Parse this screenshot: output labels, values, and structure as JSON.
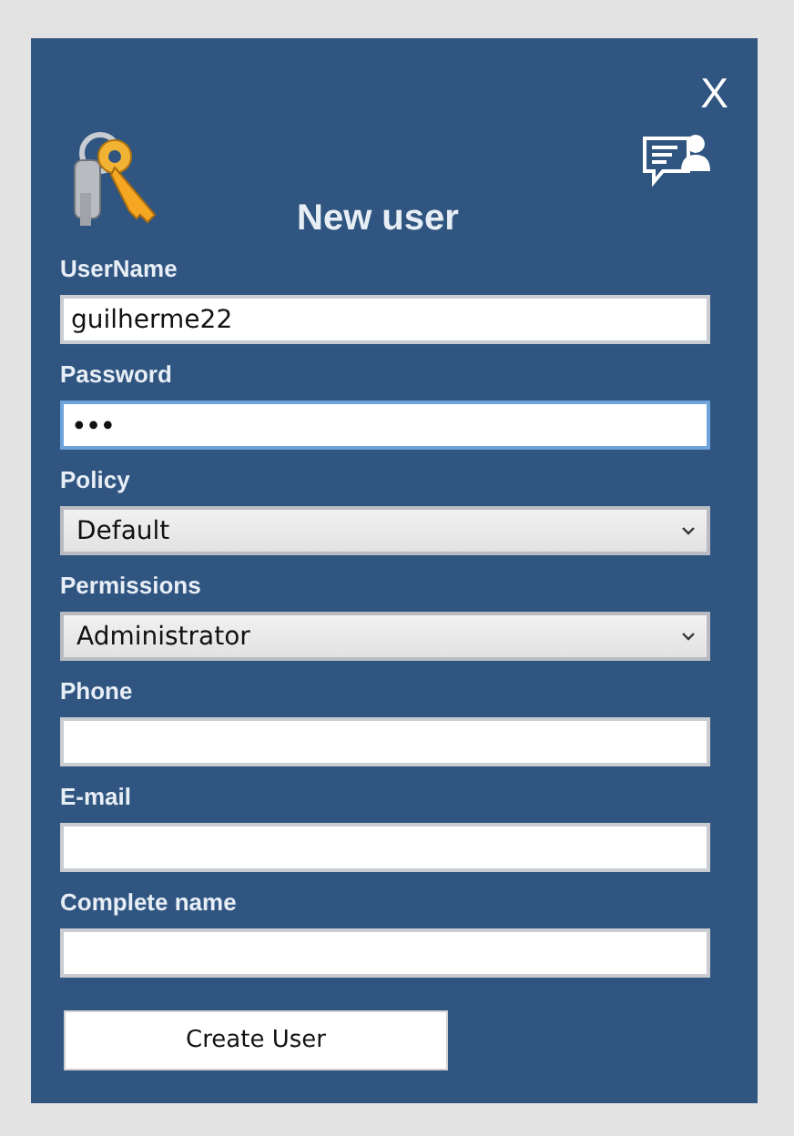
{
  "dialog": {
    "title": "New user",
    "close": "X"
  },
  "fields": [
    {
      "kind": "text",
      "label": "UserName",
      "value": "guilherme22",
      "focused": false
    },
    {
      "kind": "password",
      "label": "Password",
      "value": "•••",
      "focused": true
    },
    {
      "kind": "select",
      "label": "Policy",
      "value": "Default"
    },
    {
      "kind": "select",
      "label": "Permissions",
      "value": "Administrator"
    },
    {
      "kind": "text",
      "label": "Phone",
      "focused": false
    },
    {
      "kind": "text",
      "label": "E-mail",
      "focused": false
    },
    {
      "kind": "text",
      "label": "Complete name",
      "focused": false
    }
  ],
  "buttons": [
    "Create User"
  ]
}
